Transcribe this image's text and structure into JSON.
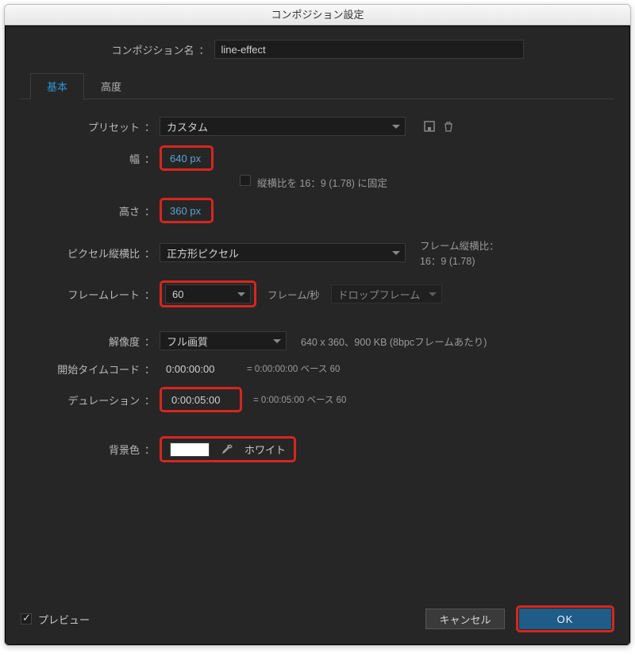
{
  "window_title": "コンポジション設定",
  "composition_name": {
    "label": "コンポジション名",
    "value": "line-effect"
  },
  "tabs": {
    "basic": "基本",
    "advanced": "高度"
  },
  "preset": {
    "label": "プリセット",
    "value": "カスタム"
  },
  "width": {
    "label": "幅",
    "value": "640",
    "unit": "px"
  },
  "height": {
    "label": "高さ",
    "value": "360",
    "unit": "px"
  },
  "lock_aspect": {
    "checked": false,
    "label": "縦横比を 16：9 (1.78) に固定"
  },
  "pixel_aspect": {
    "label": "ピクセル縦横比",
    "value": "正方形ピクセル"
  },
  "frame_aspect": {
    "label": "フレーム縦横比：",
    "value": "16：9 (1.78)"
  },
  "framerate": {
    "label": "フレームレート",
    "value": "60",
    "unit": "フレーム/秒",
    "drop_value": "ドロップフレーム"
  },
  "resolution": {
    "label": "解像度",
    "value": "フル画質",
    "info": "640 x 360、900 KB (8bpcフレームあたり)"
  },
  "start_tc": {
    "label": "開始タイムコード",
    "value": "0:00:00:00",
    "equals": "= 0:00:00:00  ベース 60"
  },
  "duration": {
    "label": "デュレーション",
    "value": "0:00:05:00",
    "equals": "= 0:00:05:00  ベース 60"
  },
  "bgcolor": {
    "label": "背景色",
    "name": "ホワイト",
    "hex": "#ffffff"
  },
  "footer": {
    "preview": "プレビュー",
    "cancel": "キャンセル",
    "ok": "OK"
  }
}
